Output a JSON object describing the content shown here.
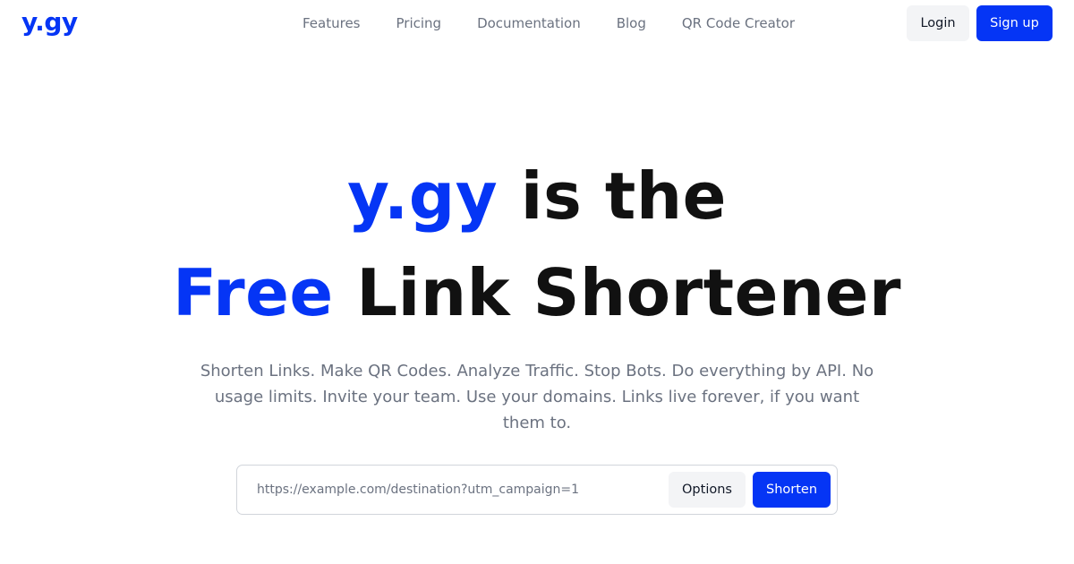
{
  "header": {
    "logo": "y.gy",
    "nav": [
      {
        "label": "Features"
      },
      {
        "label": "Pricing"
      },
      {
        "label": "Documentation"
      },
      {
        "label": "Blog"
      },
      {
        "label": "QR Code Creator"
      }
    ],
    "login_label": "Login",
    "signup_label": "Sign up"
  },
  "hero": {
    "line1_accent": "y.gy",
    "line1_rest": " is the",
    "line2_accent": "Free",
    "line2_rest": " Link Shortener",
    "subtitle": "Shorten Links. Make QR Codes. Analyze Traffic. Stop Bots. Do everything by API. No usage limits. Invite your team. Use your domains. Links live forever, if you want them to."
  },
  "shortener": {
    "input_value": "",
    "input_placeholder": "https://example.com/destination?utm_campaign=1",
    "options_label": "Options",
    "shorten_label": "Shorten"
  },
  "colors": {
    "brand": "#0535f5",
    "secondary_button": "#f3f4f6",
    "muted_text": "#6b7280"
  }
}
